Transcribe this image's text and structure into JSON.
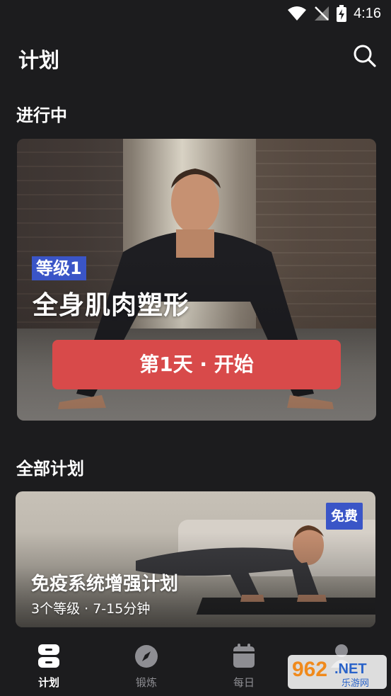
{
  "status": {
    "time": "4:16"
  },
  "header": {
    "title": "计划"
  },
  "in_progress": {
    "section_title": "进行中",
    "level_badge": "等级1",
    "plan_name": "全身肌肉塑形",
    "start_button": "第1天 · 开始"
  },
  "all_plans": {
    "section_title": "全部计划",
    "cards": [
      {
        "badge": "免费",
        "title": "免疫系统增强计划",
        "meta": "3个等级 · 7-15分钟"
      }
    ]
  },
  "bottom_nav": {
    "items": [
      {
        "label": "计划",
        "icon": "plan-icon",
        "active": true
      },
      {
        "label": "锻炼",
        "icon": "compass-icon",
        "active": false
      },
      {
        "label": "每日",
        "icon": "calendar-icon",
        "active": false
      },
      {
        "label": "",
        "icon": "profile-icon",
        "active": false
      }
    ]
  },
  "watermark": {
    "number": "962",
    "suffix": ".NET",
    "caption": "乐游网"
  },
  "colors": {
    "background": "#1c1c1e",
    "accent_blue": "#3a55c7",
    "start_red": "#d84a4a",
    "inactive": "#8e8e93"
  }
}
